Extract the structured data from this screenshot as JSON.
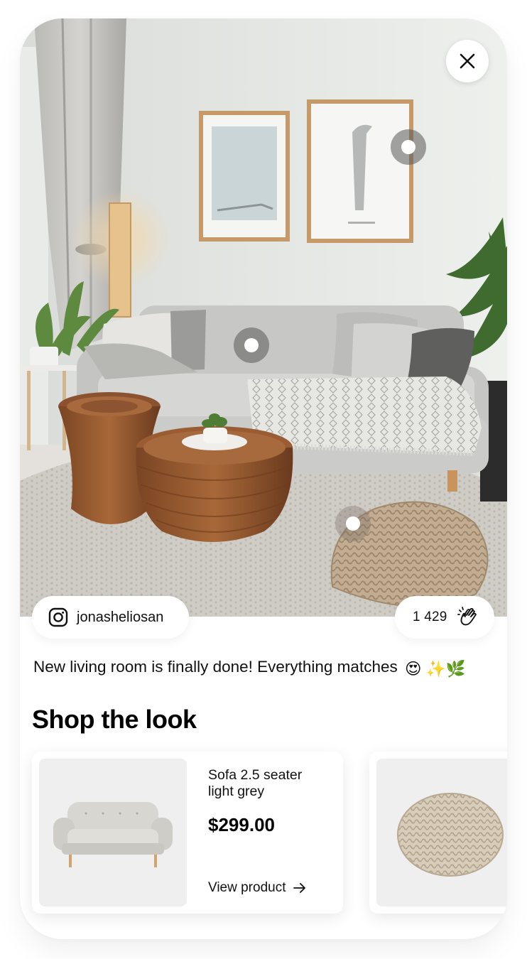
{
  "close": {
    "icon": "close-icon"
  },
  "user": {
    "icon": "instagram-icon",
    "handle": "jonasheliosan"
  },
  "applause": {
    "count": "1 429",
    "icon": "clapping-hands-icon"
  },
  "caption": {
    "text": "New living room is finally done! Everything matches",
    "emoji": "😍 ✨🌿"
  },
  "section": {
    "title": "Shop the look"
  },
  "products": [
    {
      "name": "Sofa 2.5 seater light grey",
      "price": "$299.00",
      "link": "View product"
    },
    {
      "name": "",
      "price": "",
      "link": ""
    }
  ],
  "colors": {
    "text": "#111111",
    "card_bg": "#ffffff",
    "thumb_bg": "#efefef",
    "hotspot": "#5a5a5a"
  }
}
